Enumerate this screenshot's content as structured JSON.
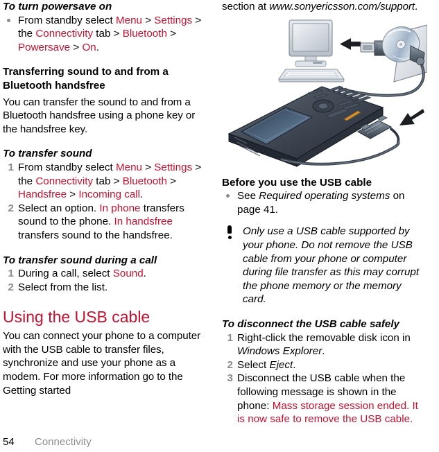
{
  "document": {
    "footer": {
      "page_number": "54",
      "chapter": "Connectivity"
    },
    "accent_color": "#c8102e",
    "marker_color": "#8a8a8a"
  },
  "left_column": {
    "heading_powersave": "To turn powersave on",
    "powersave_bullet": {
      "t1": "From standby select ",
      "m1": "Menu",
      "t2": " > ",
      "m2": "Settings",
      "t3": " > the ",
      "m3": "Connectivity",
      "t4": " tab > ",
      "m4": "Bluetooth",
      "t5": " > ",
      "m5": "Powersave",
      "t6": " > ",
      "m6": "On",
      "t7": "."
    },
    "heading_transferring": "Transferring sound to and from a Bluetooth handsfree",
    "paragraph_transferring": "You can transfer the sound to and from a Bluetooth handsfree using a phone key or the handsfree key.",
    "heading_transfer_sound": "To transfer sound",
    "transfer_step1": {
      "t1": "From standby select ",
      "m1": "Menu",
      "t2": " > ",
      "m2": "Settings",
      "t3": " > the ",
      "m3": "Connectivity",
      "t4": " tab > ",
      "m4": "Bluetooth",
      "t5": " > ",
      "m5": "Handsfree",
      "t6": " > ",
      "m6": "Incoming call",
      "t7": ".",
      "num": "1"
    },
    "transfer_step2": {
      "num": "2",
      "t1": "Select an option. ",
      "m1": "In phone",
      "t2": " transfers sound to the phone. ",
      "m2": "In handsfree",
      "t3": " transfers sound to the handsfree."
    },
    "heading_during_call": "To transfer sound during a call",
    "call_step1": {
      "num": "1",
      "t1": "During a call, select ",
      "m1": "Sound",
      "t2": "."
    },
    "call_step2": {
      "num": "2",
      "t1": "Select from the list."
    },
    "heading_usb": "Using the USB cable",
    "paragraph_usb_part1": "You can connect your phone to a computer with the USB cable to transfer files, synchronize and use your phone as a modem. For more information go to the Getting started "
  },
  "right_column": {
    "paragraph_usb_part2_pre": "section at ",
    "paragraph_usb_part2_italic": "www.sonyericsson.com/support",
    "paragraph_usb_part2_post": ".",
    "illustration_name": "phone-usb-computer-cd-illustration",
    "heading_before_use": "Before you use the USB cable",
    "before_use_bullet": {
      "t1": "See ",
      "i1": "Required operating systems",
      "t2": " on page 41."
    },
    "note": "Only use a USB cable supported by your phone. Do not remove the USB cable from your phone or computer during file transfer as this may corrupt the phone memory or the memory card.",
    "heading_disconnect": "To disconnect the USB cable safely",
    "disconnect_step1": {
      "num": "1",
      "t1": "Right-click the removable disk icon in ",
      "i1": "Windows Explorer",
      "t2": "."
    },
    "disconnect_step2": {
      "num": "2",
      "t1": "Select ",
      "i1": "Eject",
      "t2": "."
    },
    "disconnect_step3": {
      "num": "3",
      "t1": "Disconnect the USB cable when the following message is shown in the phone: ",
      "m1": "Mass storage session ended. It is now safe to remove the USB cable."
    }
  }
}
